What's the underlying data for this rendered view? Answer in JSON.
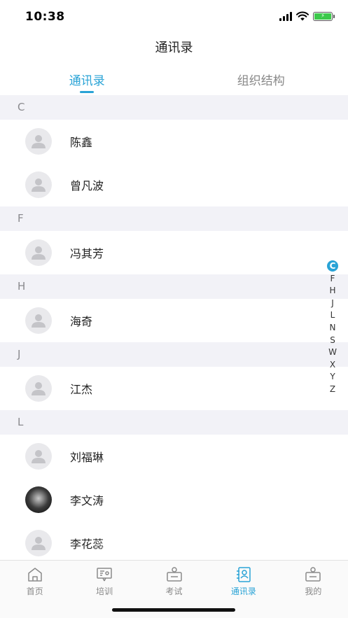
{
  "status": {
    "time": "10:38",
    "battery_color": "#3cc94b"
  },
  "nav": {
    "title": "通讯录"
  },
  "tabs": [
    {
      "label": "通讯录",
      "active": true
    },
    {
      "label": "组织结构",
      "active": false
    }
  ],
  "sections": [
    {
      "letter": "C",
      "contacts": [
        {
          "name": "陈鑫",
          "avatar": "default-avatar"
        },
        {
          "name": "曾凡波",
          "avatar": "default-avatar"
        }
      ]
    },
    {
      "letter": "F",
      "contacts": [
        {
          "name": "冯其芳",
          "avatar": "default-avatar"
        }
      ]
    },
    {
      "letter": "H",
      "contacts": [
        {
          "name": "海奇",
          "avatar": "default-avatar"
        }
      ]
    },
    {
      "letter": "J",
      "contacts": [
        {
          "name": "江杰",
          "avatar": "default-avatar"
        }
      ]
    },
    {
      "letter": "L",
      "contacts": [
        {
          "name": "刘福琳",
          "avatar": "default-avatar"
        },
        {
          "name": "李文涛",
          "avatar": "photo-avatar"
        },
        {
          "name": "李花蕊",
          "avatar": "default-avatar"
        }
      ]
    }
  ],
  "index_bar": {
    "letters": [
      "C",
      "F",
      "H",
      "J",
      "L",
      "N",
      "S",
      "W",
      "X",
      "Y",
      "Z"
    ],
    "active": "C"
  },
  "tab_bar": {
    "items": [
      {
        "label": "首页",
        "icon": "home-icon"
      },
      {
        "label": "培训",
        "icon": "training-icon"
      },
      {
        "label": "考试",
        "icon": "exam-icon"
      },
      {
        "label": "通讯录",
        "icon": "contacts-icon"
      },
      {
        "label": "我的",
        "icon": "profile-icon"
      }
    ],
    "active_index": 3
  },
  "colors": {
    "accent": "#29a3d6",
    "section_bg": "#f2f2f7"
  }
}
